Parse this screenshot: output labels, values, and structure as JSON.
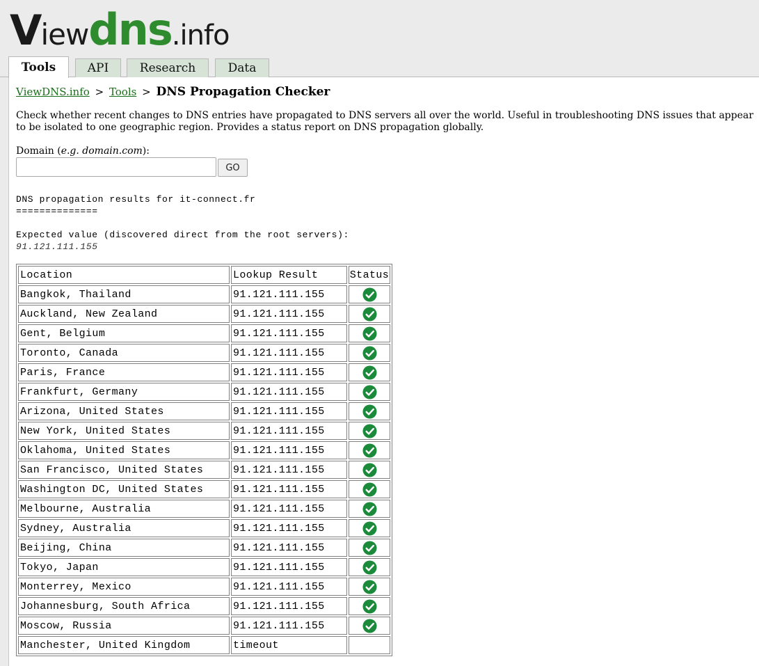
{
  "logo": {
    "part1": "V",
    "part2": "iew",
    "part3": "dns",
    "part4": ".info"
  },
  "tabs": [
    {
      "label": "Tools",
      "active": true
    },
    {
      "label": "API",
      "active": false
    },
    {
      "label": "Research",
      "active": false
    },
    {
      "label": "Data",
      "active": false
    }
  ],
  "breadcrumb": {
    "home": "ViewDNS.info",
    "sep": ">",
    "section": "Tools",
    "current": "DNS Propagation Checker"
  },
  "description": "Check whether recent changes to DNS entries have propagated to DNS servers all over the world. Useful in troubleshooting DNS issues that appear to be isolated to one geographic region. Provides a status report on DNS propagation globally.",
  "form": {
    "label_prefix": "Domain (",
    "label_example": "e.g. domain.com",
    "label_suffix": "):",
    "input_value": "",
    "button_label": "GO"
  },
  "results": {
    "heading": "DNS propagation results for it-connect.fr",
    "underline": "==============",
    "expected_label": "Expected value (discovered direct from the root servers):",
    "expected_value": "91.121.111.155",
    "columns": {
      "location": "Location",
      "result": "Lookup Result",
      "status": "Status"
    },
    "status_colors": {
      "ok": "#1b8a3a"
    },
    "rows": [
      {
        "location": "Bangkok, Thailand",
        "result": "91.121.111.155",
        "status": "ok"
      },
      {
        "location": "Auckland, New Zealand",
        "result": "91.121.111.155",
        "status": "ok"
      },
      {
        "location": "Gent, Belgium",
        "result": "91.121.111.155",
        "status": "ok"
      },
      {
        "location": "Toronto, Canada",
        "result": "91.121.111.155",
        "status": "ok"
      },
      {
        "location": "Paris, France",
        "result": "91.121.111.155",
        "status": "ok"
      },
      {
        "location": "Frankfurt, Germany",
        "result": "91.121.111.155",
        "status": "ok"
      },
      {
        "location": "Arizona, United States",
        "result": "91.121.111.155",
        "status": "ok"
      },
      {
        "location": "New York, United States",
        "result": "91.121.111.155",
        "status": "ok"
      },
      {
        "location": "Oklahoma, United States",
        "result": "91.121.111.155",
        "status": "ok"
      },
      {
        "location": "San Francisco, United States",
        "result": "91.121.111.155",
        "status": "ok"
      },
      {
        "location": "Washington DC, United States",
        "result": "91.121.111.155",
        "status": "ok"
      },
      {
        "location": "Melbourne, Australia",
        "result": "91.121.111.155",
        "status": "ok"
      },
      {
        "location": "Sydney, Australia",
        "result": "91.121.111.155",
        "status": "ok"
      },
      {
        "location": "Beijing, China",
        "result": "91.121.111.155",
        "status": "ok"
      },
      {
        "location": "Tokyo, Japan",
        "result": "91.121.111.155",
        "status": "ok"
      },
      {
        "location": "Monterrey, Mexico",
        "result": "91.121.111.155",
        "status": "ok"
      },
      {
        "location": "Johannesburg, South Africa",
        "result": "91.121.111.155",
        "status": "ok"
      },
      {
        "location": "Moscow, Russia",
        "result": "91.121.111.155",
        "status": "ok"
      },
      {
        "location": "Manchester, United Kingdom",
        "result": "timeout",
        "status": "none"
      }
    ]
  }
}
